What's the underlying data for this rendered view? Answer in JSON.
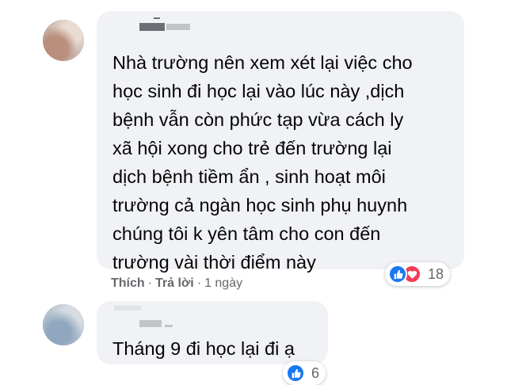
{
  "comments": [
    {
      "author": "",
      "text": "Nhà trường nên xem xét lại việc cho\nhọc sinh đi học lại vào lúc này ,dịch\nbệnh vẫn còn phức tạp vừa cách ly\nxã hội xong cho trẻ đến trường lại\ndịch bệnh tiềm ẩn , sinh hoạt môi\ntrường cả ngàn học sinh phụ huynh\nchúng tôi k yên tâm cho con đến\ntrường vài thời điểm này",
      "actions": {
        "like": "Thích",
        "reply": "Trả lời",
        "time": "1 ngày"
      },
      "reactions": {
        "icons": [
          "like-icon",
          "love-icon"
        ],
        "count": "18"
      }
    },
    {
      "author": "",
      "text": "Tháng 9 đi học lại đi ạ",
      "reactions": {
        "icons": [
          "like-icon"
        ],
        "count": "6"
      }
    }
  ],
  "colors": {
    "bubble": "#f0f2f5",
    "like": "#1877f2",
    "love": "#f33e58",
    "meta": "#65676b"
  }
}
